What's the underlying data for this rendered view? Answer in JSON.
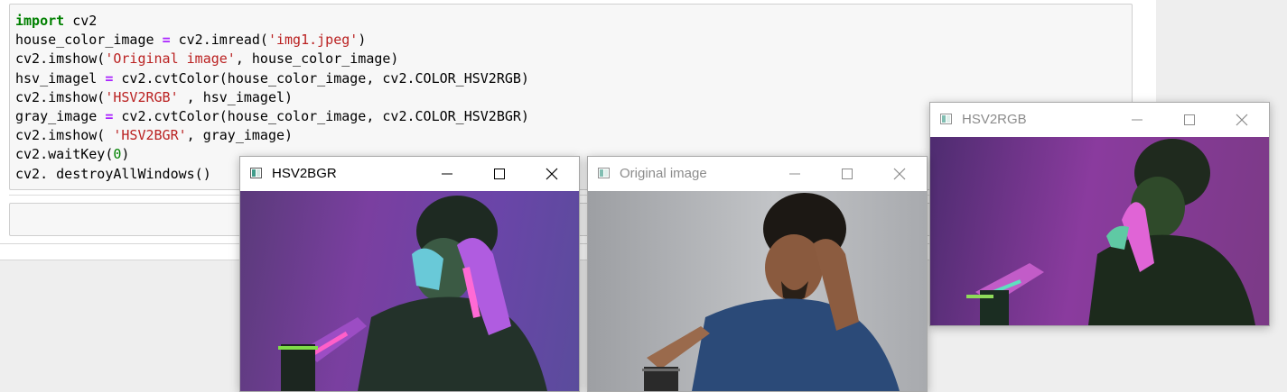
{
  "notebook": {
    "code_lines": [
      {
        "tokens": [
          {
            "t": "import",
            "c": "kw"
          },
          {
            "t": " cv2"
          }
        ]
      },
      {
        "tokens": [
          {
            "t": "house_color_image "
          },
          {
            "t": "=",
            "c": "op"
          },
          {
            "t": " cv2.imread("
          },
          {
            "t": "'img1.jpeg'",
            "c": "str"
          },
          {
            "t": ")"
          }
        ]
      },
      {
        "tokens": [
          {
            "t": "cv2.imshow("
          },
          {
            "t": "'Original image'",
            "c": "str"
          },
          {
            "t": ", house_color_image)"
          }
        ]
      },
      {
        "tokens": [
          {
            "t": "hsv_imagel "
          },
          {
            "t": "=",
            "c": "op"
          },
          {
            "t": " cv2.cvtColor(house_color_image, cv2.COLOR_HSV2RGB)"
          }
        ]
      },
      {
        "tokens": [
          {
            "t": "cv2.imshow("
          },
          {
            "t": "'HSV2RGB'",
            "c": "str"
          },
          {
            "t": " , hsv_imagel)"
          }
        ]
      },
      {
        "tokens": [
          {
            "t": "gray_image "
          },
          {
            "t": "=",
            "c": "op"
          },
          {
            "t": " cv2.cvtColor(house_color_image, cv2.COLOR_HSV2BGR)"
          }
        ]
      },
      {
        "tokens": [
          {
            "t": "cv2.imshow( "
          },
          {
            "t": "'HSV2BGR'",
            "c": "str"
          },
          {
            "t": ", gray_image)"
          }
        ]
      },
      {
        "tokens": [
          {
            "t": "cv2.waitKey("
          },
          {
            "t": "0",
            "c": "num"
          },
          {
            "t": ")"
          }
        ]
      },
      {
        "tokens": [
          {
            "t": "cv2. destroyAllWindows()"
          }
        ]
      }
    ]
  },
  "windows": {
    "hsv2bgr": {
      "title": "HSV2BGR",
      "active": true
    },
    "original": {
      "title": "Original image",
      "active": false
    },
    "hsv2rgb": {
      "title": "HSV2RGB",
      "active": false
    }
  },
  "icons": {
    "app": "opencv-window-icon",
    "minimize": "minimize-icon",
    "maximize": "maximize-icon",
    "close": "close-icon"
  }
}
